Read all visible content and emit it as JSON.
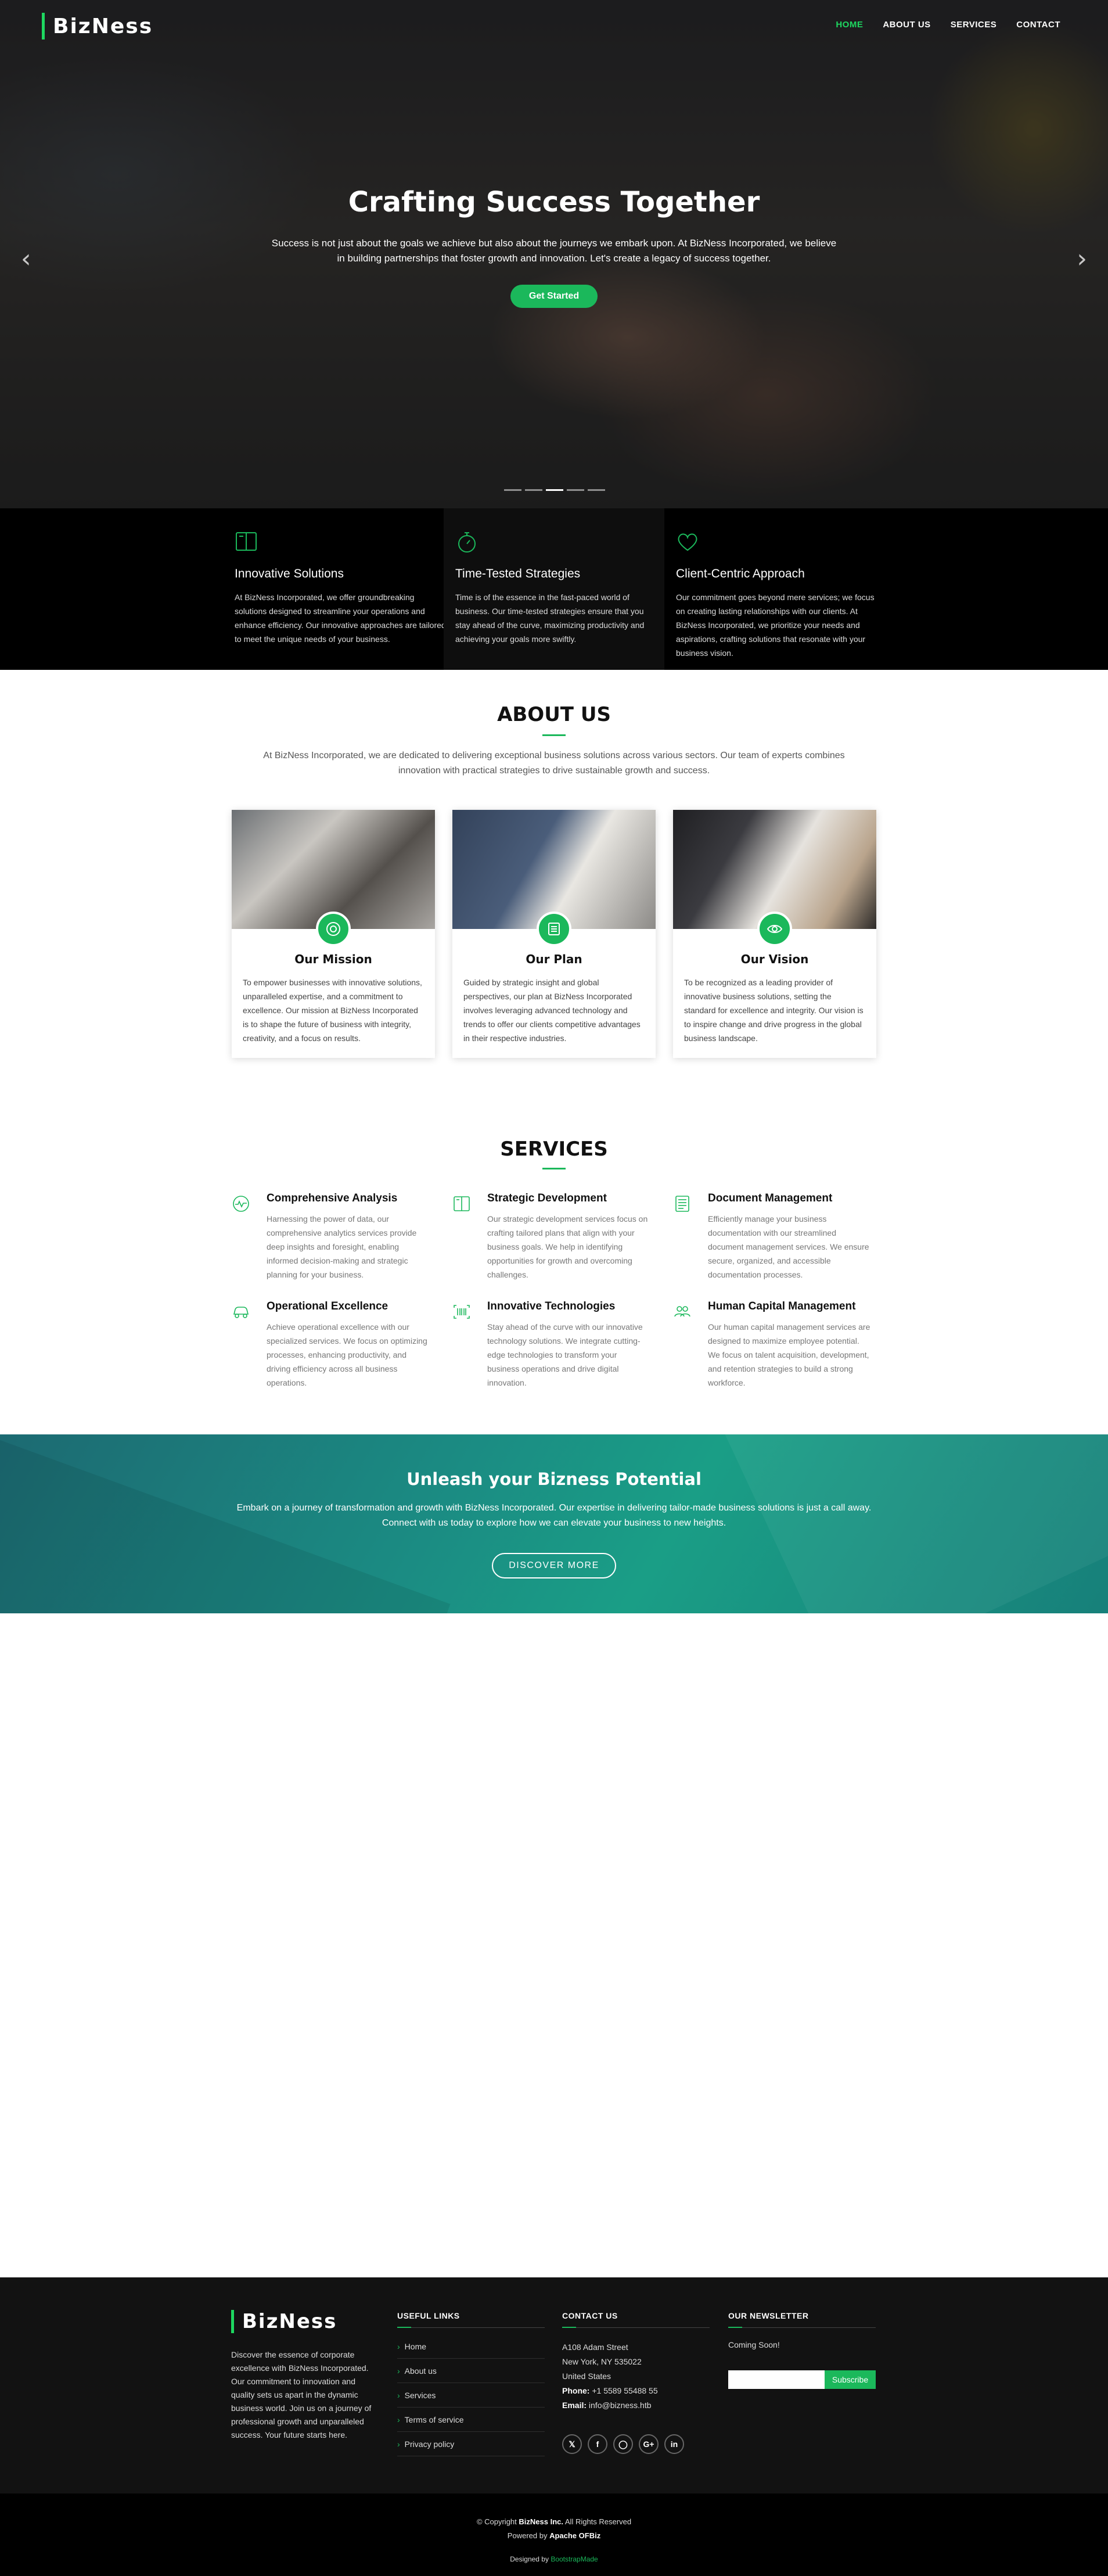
{
  "header": {
    "logo": "BizNess",
    "nav": [
      "HOME",
      "ABOUT US",
      "SERVICES",
      "CONTACT"
    ]
  },
  "hero": {
    "title": "Crafting Success Together",
    "text": "Success is not just about the goals we achieve but also about the journeys we embark upon. At BizNess Incorporated, we believe in building partnerships that foster growth and innovation. Let's create a legacy of success together.",
    "button": "Get Started",
    "prev_icon": "chevron-left-icon",
    "next_icon": "chevron-right-icon",
    "slide_count": 5,
    "active_slide": 3
  },
  "features": [
    {
      "icon": "book-icon",
      "title": "Innovative Solutions",
      "text": "At BizNess Incorporated, we offer groundbreaking solutions designed to streamline your operations and enhance efficiency. Our innovative approaches are tailored to meet the unique needs of your business."
    },
    {
      "icon": "stopwatch-icon",
      "title": "Time-Tested Strategies",
      "text": "Time is of the essence in the fast-paced world of business. Our time-tested strategies ensure that you stay ahead of the curve, maximizing productivity and achieving your goals more swiftly."
    },
    {
      "icon": "heart-icon",
      "title": "Client-Centric Approach",
      "text": "Our commitment goes beyond mere services; we focus on creating lasting relationships with our clients. At BizNess Incorporated, we prioritize your needs and aspirations, crafting solutions that resonate with your business vision."
    }
  ],
  "about": {
    "title": "ABOUT US",
    "text": "At BizNess Incorporated, we are dedicated to delivering exceptional business solutions across various sectors. Our team of experts combines innovation with practical strategies to drive sustainable growth and success.",
    "cards": [
      {
        "title": "Our Mission",
        "icon": "target-icon",
        "text": "To empower businesses with innovative solutions, unparalleled expertise, and a commitment to excellence. Our mission at BizNess Incorporated is to shape the future of business with integrity, creativity, and a focus on results."
      },
      {
        "title": "Our Plan",
        "icon": "list-icon",
        "text": "Guided by strategic insight and global perspectives, our plan at BizNess Incorporated involves leveraging advanced technology and trends to offer our clients competitive advantages in their respective industries."
      },
      {
        "title": "Our Vision",
        "icon": "eye-icon",
        "text": "To be recognized as a leading provider of innovative business solutions, setting the standard for excellence and integrity. Our vision is to inspire change and drive progress in the global business landscape."
      }
    ]
  },
  "services": {
    "title": "SERVICES",
    "items": [
      {
        "icon": "activity-icon",
        "title": "Comprehensive Analysis",
        "text": "Harnessing the power of data, our comprehensive analytics services provide deep insights and foresight, enabling informed decision-making and strategic planning for your business."
      },
      {
        "icon": "book-icon",
        "title": "Strategic Development",
        "text": "Our strategic development services focus on crafting tailored plans that align with your business goals. We help in identifying opportunities for growth and overcoming challenges."
      },
      {
        "icon": "document-icon",
        "title": "Document Management",
        "text": "Efficiently manage your business documentation with our streamlined document management services. We ensure secure, organized, and accessible documentation processes."
      },
      {
        "icon": "car-icon",
        "title": "Operational Excellence",
        "text": "Achieve operational excellence with our specialized services. We focus on optimizing processes, enhancing productivity, and driving efficiency across all business operations."
      },
      {
        "icon": "barcode-icon",
        "title": "Innovative Technologies",
        "text": "Stay ahead of the curve with our innovative technology solutions. We integrate cutting-edge technologies to transform your business operations and drive digital innovation."
      },
      {
        "icon": "people-icon",
        "title": "Human Capital Management",
        "text": "Our human capital management services are designed to maximize employee potential. We focus on talent acquisition, development, and retention strategies to build a strong workforce."
      }
    ]
  },
  "cta": {
    "title": "Unleash your Bizness Potential",
    "text": "Embark on a journey of transformation and growth with BizNess Incorporated. Our expertise in delivering tailor-made business solutions is just a call away. Connect with us today to explore how we can elevate your business to new heights.",
    "button": "DISCOVER MORE"
  },
  "footer": {
    "logo": "BizNess",
    "about": "Discover the essence of corporate excellence with BizNess Incorporated. Our commitment to innovation and quality sets us apart in the dynamic business world. Join us on a journey of professional growth and unparalleled success. Your future starts here.",
    "links_title": "USEFUL LINKS",
    "links": [
      "Home",
      "About us",
      "Services",
      "Terms of service",
      "Privacy policy"
    ],
    "contact_title": "CONTACT US",
    "address1": "A108 Adam Street",
    "address2": "New York, NY 535022",
    "country": "United States",
    "phone_label": "Phone:",
    "phone": "+1 5589 55488 55",
    "email_label": "Email:",
    "email": "info@bizness.htb",
    "socials": [
      "twitter-icon",
      "facebook-icon",
      "instagram-icon",
      "google-plus-icon",
      "linkedin-icon"
    ],
    "newsletter_title": "OUR NEWSLETTER",
    "newsletter_text": "Coming Soon!",
    "newsletter_placeholder": "",
    "subscribe": "Subscribe"
  },
  "copyright": {
    "prefix": "© Copyright",
    "company": "BizNess Inc.",
    "suffix": "All Rights Reserved",
    "powered_prefix": "Powered by",
    "powered": "Apache OFBiz",
    "designed_prefix": "Designed by",
    "designed": "BootstrapMade"
  },
  "colors": {
    "accent": "#1bb85b",
    "dark": "#000000",
    "cta": "#1a9e86"
  }
}
